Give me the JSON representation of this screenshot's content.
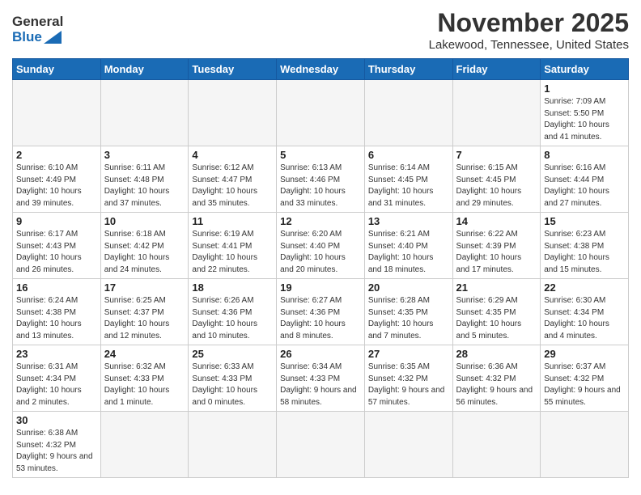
{
  "header": {
    "logo_general": "General",
    "logo_blue": "Blue",
    "title": "November 2025",
    "subtitle": "Lakewood, Tennessee, United States"
  },
  "weekdays": [
    "Sunday",
    "Monday",
    "Tuesday",
    "Wednesday",
    "Thursday",
    "Friday",
    "Saturday"
  ],
  "weeks": [
    [
      {
        "day": "",
        "info": ""
      },
      {
        "day": "",
        "info": ""
      },
      {
        "day": "",
        "info": ""
      },
      {
        "day": "",
        "info": ""
      },
      {
        "day": "",
        "info": ""
      },
      {
        "day": "",
        "info": ""
      },
      {
        "day": "1",
        "info": "Sunrise: 7:09 AM\nSunset: 5:50 PM\nDaylight: 10 hours\nand 41 minutes."
      }
    ],
    [
      {
        "day": "2",
        "info": "Sunrise: 6:10 AM\nSunset: 4:49 PM\nDaylight: 10 hours\nand 39 minutes."
      },
      {
        "day": "3",
        "info": "Sunrise: 6:11 AM\nSunset: 4:48 PM\nDaylight: 10 hours\nand 37 minutes."
      },
      {
        "day": "4",
        "info": "Sunrise: 6:12 AM\nSunset: 4:47 PM\nDaylight: 10 hours\nand 35 minutes."
      },
      {
        "day": "5",
        "info": "Sunrise: 6:13 AM\nSunset: 4:46 PM\nDaylight: 10 hours\nand 33 minutes."
      },
      {
        "day": "6",
        "info": "Sunrise: 6:14 AM\nSunset: 4:45 PM\nDaylight: 10 hours\nand 31 minutes."
      },
      {
        "day": "7",
        "info": "Sunrise: 6:15 AM\nSunset: 4:45 PM\nDaylight: 10 hours\nand 29 minutes."
      },
      {
        "day": "8",
        "info": "Sunrise: 6:16 AM\nSunset: 4:44 PM\nDaylight: 10 hours\nand 27 minutes."
      }
    ],
    [
      {
        "day": "9",
        "info": "Sunrise: 6:17 AM\nSunset: 4:43 PM\nDaylight: 10 hours\nand 26 minutes."
      },
      {
        "day": "10",
        "info": "Sunrise: 6:18 AM\nSunset: 4:42 PM\nDaylight: 10 hours\nand 24 minutes."
      },
      {
        "day": "11",
        "info": "Sunrise: 6:19 AM\nSunset: 4:41 PM\nDaylight: 10 hours\nand 22 minutes."
      },
      {
        "day": "12",
        "info": "Sunrise: 6:20 AM\nSunset: 4:40 PM\nDaylight: 10 hours\nand 20 minutes."
      },
      {
        "day": "13",
        "info": "Sunrise: 6:21 AM\nSunset: 4:40 PM\nDaylight: 10 hours\nand 18 minutes."
      },
      {
        "day": "14",
        "info": "Sunrise: 6:22 AM\nSunset: 4:39 PM\nDaylight: 10 hours\nand 17 minutes."
      },
      {
        "day": "15",
        "info": "Sunrise: 6:23 AM\nSunset: 4:38 PM\nDaylight: 10 hours\nand 15 minutes."
      }
    ],
    [
      {
        "day": "16",
        "info": "Sunrise: 6:24 AM\nSunset: 4:38 PM\nDaylight: 10 hours\nand 13 minutes."
      },
      {
        "day": "17",
        "info": "Sunrise: 6:25 AM\nSunset: 4:37 PM\nDaylight: 10 hours\nand 12 minutes."
      },
      {
        "day": "18",
        "info": "Sunrise: 6:26 AM\nSunset: 4:36 PM\nDaylight: 10 hours\nand 10 minutes."
      },
      {
        "day": "19",
        "info": "Sunrise: 6:27 AM\nSunset: 4:36 PM\nDaylight: 10 hours\nand 8 minutes."
      },
      {
        "day": "20",
        "info": "Sunrise: 6:28 AM\nSunset: 4:35 PM\nDaylight: 10 hours\nand 7 minutes."
      },
      {
        "day": "21",
        "info": "Sunrise: 6:29 AM\nSunset: 4:35 PM\nDaylight: 10 hours\nand 5 minutes."
      },
      {
        "day": "22",
        "info": "Sunrise: 6:30 AM\nSunset: 4:34 PM\nDaylight: 10 hours\nand 4 minutes."
      }
    ],
    [
      {
        "day": "23",
        "info": "Sunrise: 6:31 AM\nSunset: 4:34 PM\nDaylight: 10 hours\nand 2 minutes."
      },
      {
        "day": "24",
        "info": "Sunrise: 6:32 AM\nSunset: 4:33 PM\nDaylight: 10 hours\nand 1 minute."
      },
      {
        "day": "25",
        "info": "Sunrise: 6:33 AM\nSunset: 4:33 PM\nDaylight: 10 hours\nand 0 minutes."
      },
      {
        "day": "26",
        "info": "Sunrise: 6:34 AM\nSunset: 4:33 PM\nDaylight: 9 hours\nand 58 minutes."
      },
      {
        "day": "27",
        "info": "Sunrise: 6:35 AM\nSunset: 4:32 PM\nDaylight: 9 hours\nand 57 minutes."
      },
      {
        "day": "28",
        "info": "Sunrise: 6:36 AM\nSunset: 4:32 PM\nDaylight: 9 hours\nand 56 minutes."
      },
      {
        "day": "29",
        "info": "Sunrise: 6:37 AM\nSunset: 4:32 PM\nDaylight: 9 hours\nand 55 minutes."
      }
    ],
    [
      {
        "day": "30",
        "info": "Sunrise: 6:38 AM\nSunset: 4:32 PM\nDaylight: 9 hours\nand 53 minutes."
      },
      {
        "day": "",
        "info": ""
      },
      {
        "day": "",
        "info": ""
      },
      {
        "day": "",
        "info": ""
      },
      {
        "day": "",
        "info": ""
      },
      {
        "day": "",
        "info": ""
      },
      {
        "day": "",
        "info": ""
      }
    ]
  ]
}
